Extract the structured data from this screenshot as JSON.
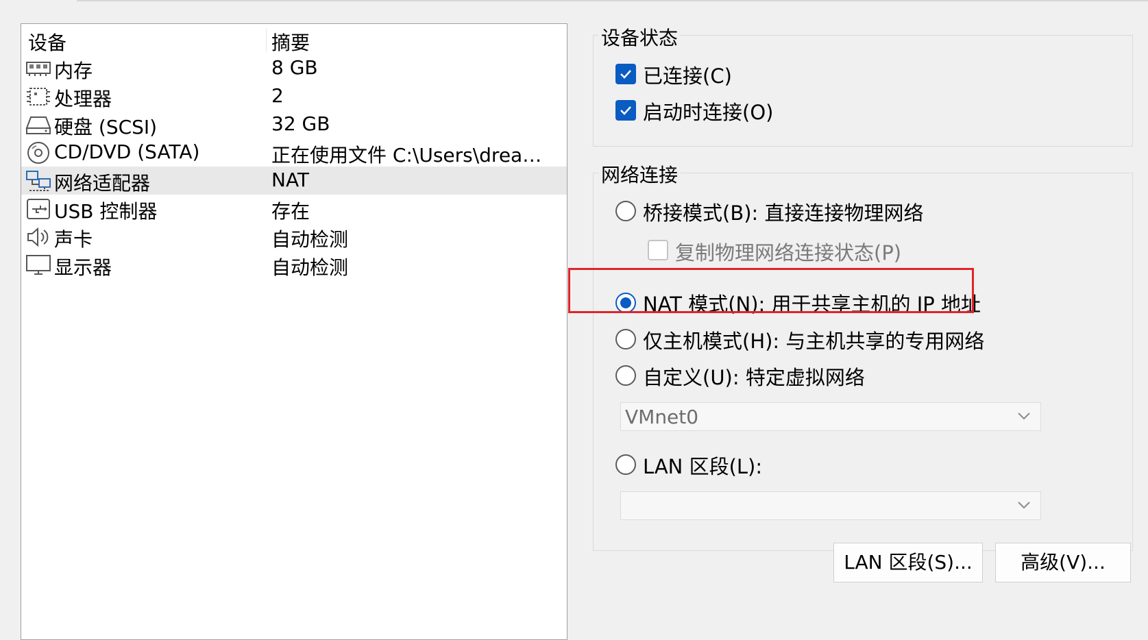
{
  "device_list": {
    "header": {
      "device": "设备",
      "summary": "摘要"
    },
    "rows": [
      {
        "icon": "memory-icon",
        "name": "内存",
        "summary": "8 GB"
      },
      {
        "icon": "processor-icon",
        "name": "处理器",
        "summary": "2"
      },
      {
        "icon": "hard-disk-icon",
        "name": "硬盘 (SCSI)",
        "summary": "32 GB"
      },
      {
        "icon": "cd-dvd-icon",
        "name": "CD/DVD (SATA)",
        "summary": "正在使用文件 C:\\Users\\dream..."
      },
      {
        "icon": "network-adapter-icon",
        "name": "网络适配器",
        "summary": "NAT",
        "selected": true
      },
      {
        "icon": "usb-icon",
        "name": "USB 控制器",
        "summary": "存在"
      },
      {
        "icon": "sound-card-icon",
        "name": "声卡",
        "summary": "自动检测"
      },
      {
        "icon": "display-icon",
        "name": "显示器",
        "summary": "自动检测"
      }
    ]
  },
  "device_status": {
    "title": "设备状态",
    "connected": {
      "label": "已连接(C)",
      "checked": true
    },
    "connect_at_power_on": {
      "label": "启动时连接(O)",
      "checked": true
    }
  },
  "network_connection": {
    "title": "网络连接",
    "bridged": {
      "label": "桥接模式(B): 直接连接物理网络",
      "selected": false
    },
    "replicate_state": {
      "label": "复制物理网络连接状态(P)",
      "checked": false,
      "enabled": false
    },
    "nat": {
      "label": "NAT 模式(N): 用于共享主机的 IP 地址",
      "selected": true
    },
    "host_only": {
      "label": "仅主机模式(H): 与主机共享的专用网络",
      "selected": false
    },
    "custom": {
      "label": "自定义(U): 特定虚拟网络",
      "selected": false
    },
    "custom_network_value": "VMnet0",
    "lan_segment": {
      "label": "LAN 区段(L):",
      "selected": false
    },
    "lan_segment_value": ""
  },
  "buttons": {
    "lan_segments": "LAN 区段(S)...",
    "advanced": "高级(V)..."
  },
  "colors": {
    "accent": "#0a5bc2",
    "highlight_box": "#e0242b",
    "selected_row": "#e8e8e8"
  }
}
